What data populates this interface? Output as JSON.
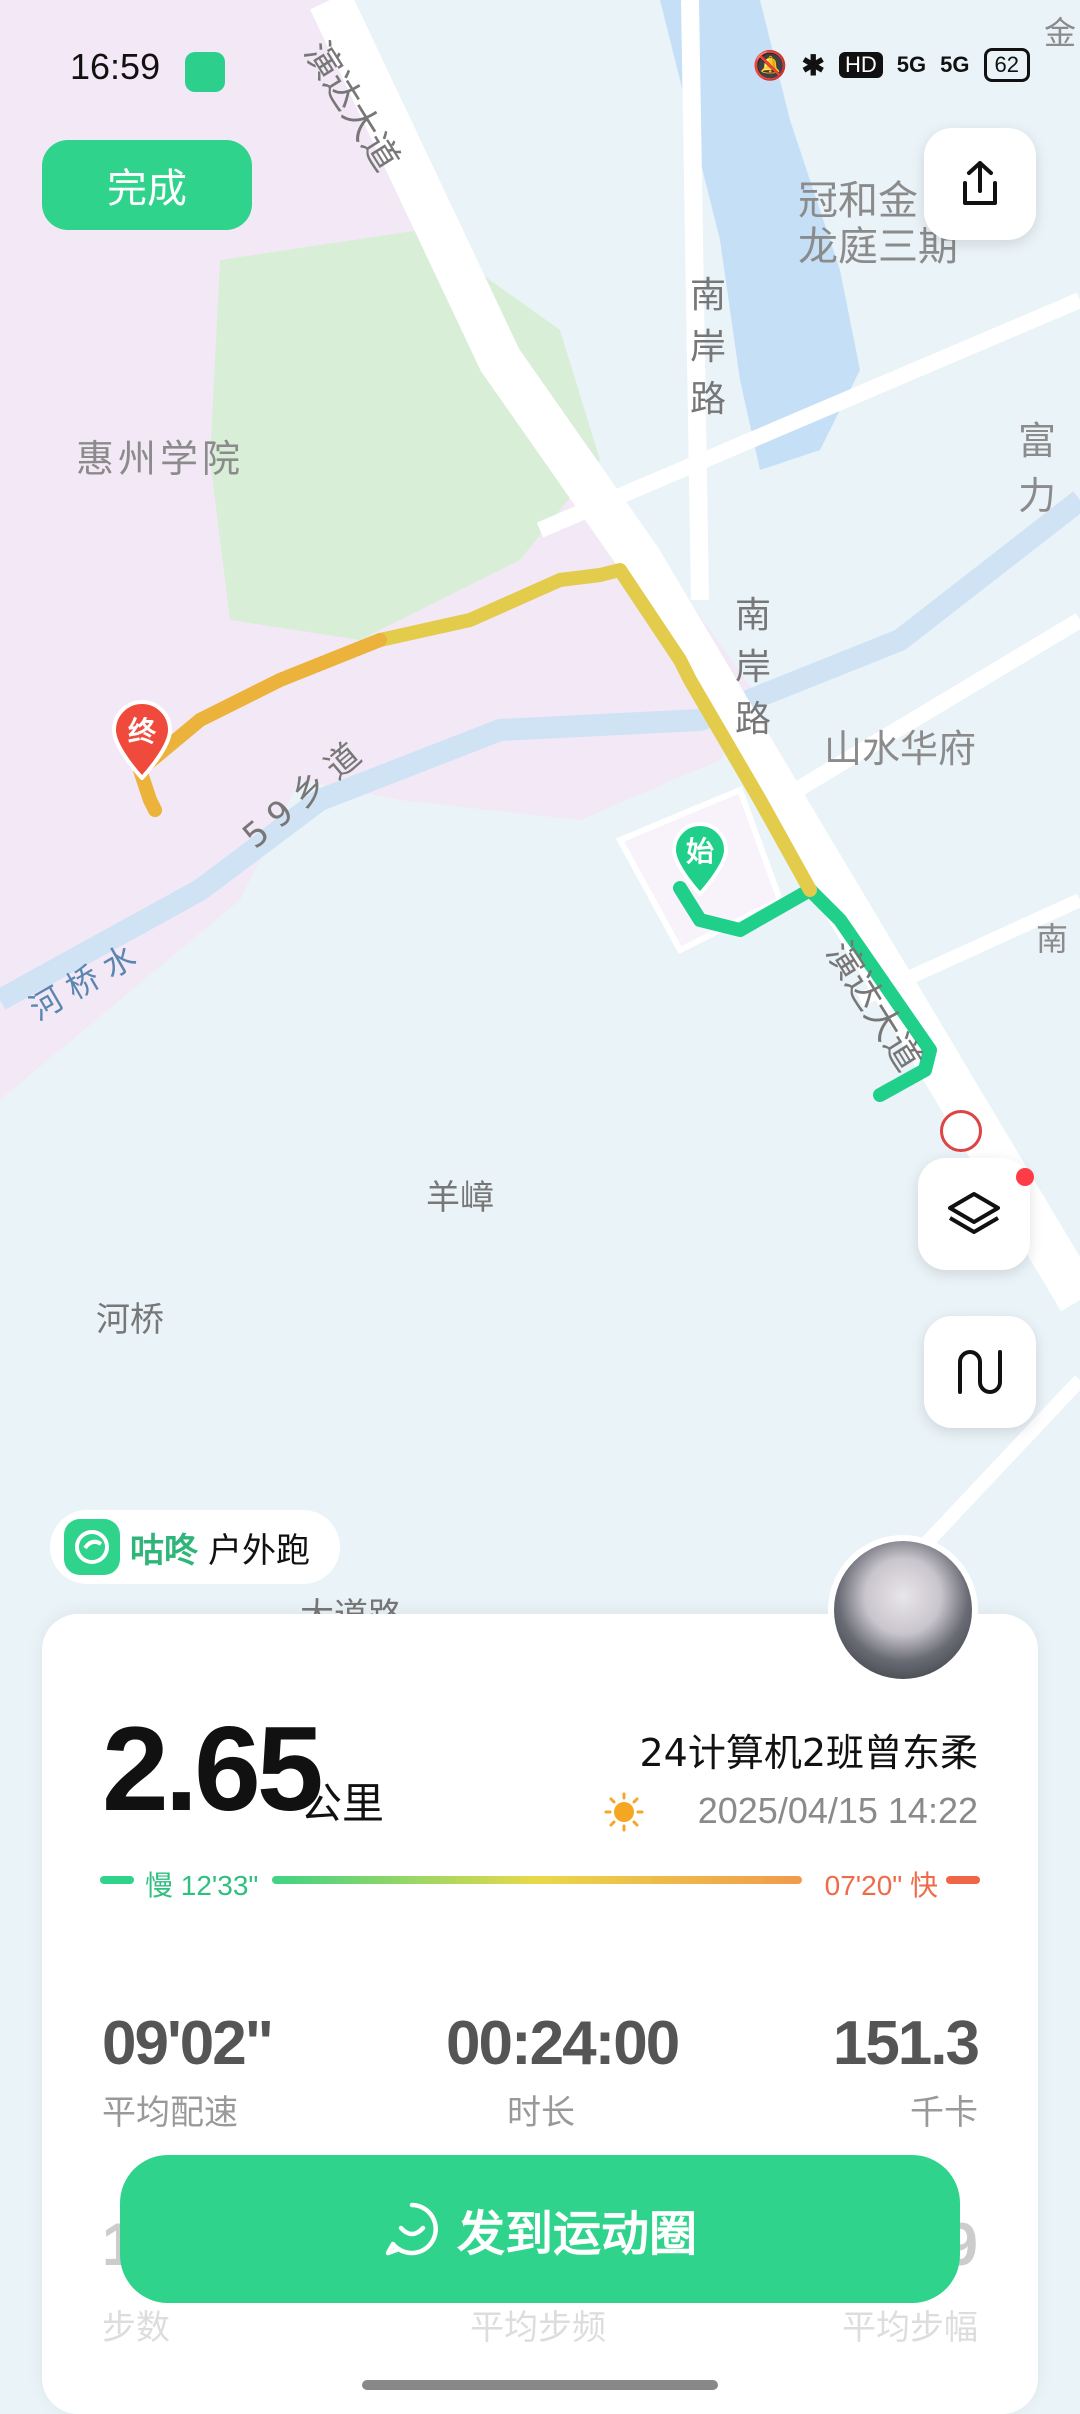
{
  "status_bar": {
    "time": "16:59",
    "network": "HD",
    "signal1": "5G",
    "signal2": "5G",
    "battery": "62"
  },
  "header": {
    "done_label": "完成"
  },
  "map": {
    "labels": {
      "road_top": "演达大道",
      "road_mid": "演达大道",
      "south_bank_1": "南岸路",
      "south_bank_2": "南岸路",
      "school": "惠州学院",
      "village_road": "59乡道",
      "river": "河桥水",
      "estate1": "冠和金",
      "estate2": "龙庭三期",
      "shanshui": "山水华府",
      "fu": "富力",
      "jin": "金",
      "nan": "南",
      "yangzhang": "羊嶂",
      "heqiao": "河桥",
      "bottom_road": "大道路"
    },
    "start_marker": "始",
    "end_marker": "终",
    "colors": {
      "route_green": "#1fcf8a",
      "route_yellow": "#e8c84a",
      "route_orange": "#eab23c",
      "end_marker": "#ef4a3b",
      "water": "#bcdcf6",
      "campus": "#f5e8fb",
      "green_area": "#d8f0d4"
    }
  },
  "brand": {
    "name_bold": "咕咚",
    "name_rest": "户外跑"
  },
  "summary": {
    "distance": "2.65",
    "distance_unit": "公里",
    "user": "24计算机2班曾东柔",
    "datetime": "2025/04/15 14:22",
    "pace_slow_label": "慢 12'33\"",
    "pace_fast_label": "07'20\" 快"
  },
  "stats": [
    {
      "value": "09'02\"",
      "label": "平均配速"
    },
    {
      "value": "00:24:00",
      "label": "时长"
    },
    {
      "value": "151.3",
      "label": "千卡"
    }
  ],
  "stats_row2": [
    {
      "value": "1",
      "label": "步数"
    },
    {
      "value": "",
      "label": "平均步频"
    },
    {
      "value": "9",
      "label": "平均步幅"
    }
  ],
  "share_button": "发到运动圈"
}
